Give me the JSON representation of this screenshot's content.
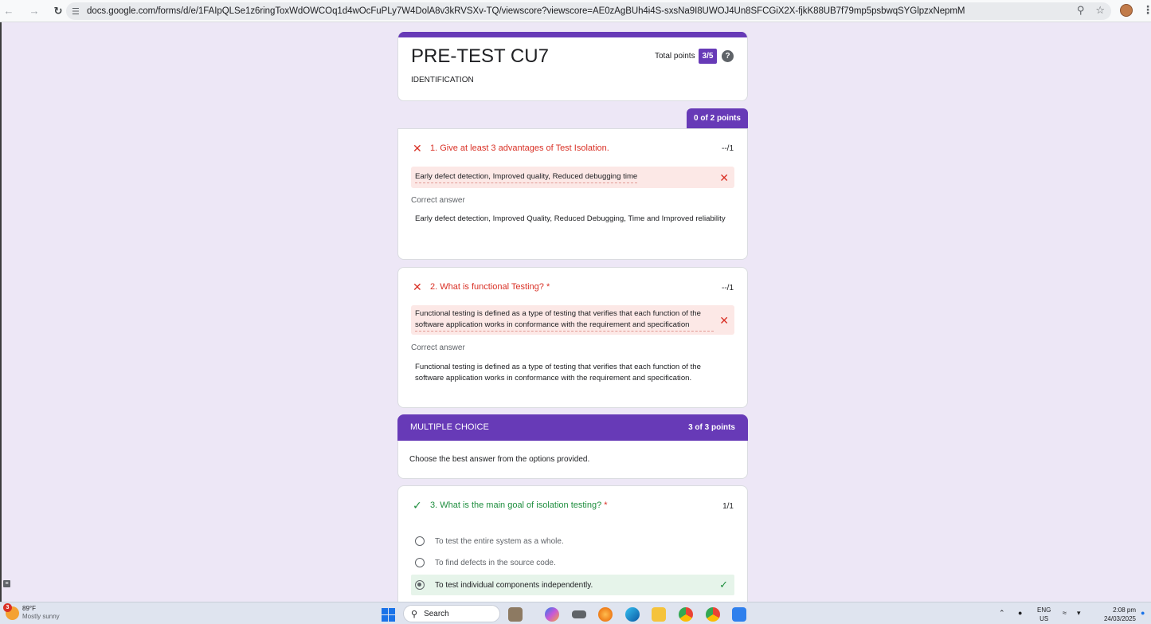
{
  "browser": {
    "url": "docs.google.com/forms/d/e/1FAIpQLSe1z6ringToxWdOWCOq1d4wOcFuPLy7W4DolA8v3kRVSXv-TQ/viewscore?viewscore=AE0zAgBUh4i4S-sxsNa9I8UWOJ4Un8SFCGiX2X-fjkK88UB7f79mp5psbwqSYGlpzxNepmM",
    "icons": [
      "back-arrow-icon",
      "forward-arrow-icon",
      "reload-icon",
      "site-info-icon",
      "zoom-icon",
      "bookmark-star-icon",
      "profile-avatar",
      "menu-kebab-icon"
    ]
  },
  "form": {
    "title": "PRE-TEST CU7",
    "description": "IDENTIFICATION",
    "total_points_label": "Total points",
    "total_points_value": "3/5",
    "help_symbol": "?",
    "accent_color": "#673ab7"
  },
  "section1": {
    "points": "0 of 2 points"
  },
  "questions": [
    {
      "number_title": "1. Give at least 3 advantages of Test Isolation.",
      "required_mark": "",
      "status": "incorrect",
      "score": "--/1",
      "response": "Early defect detection, Improved quality, Reduced debugging time",
      "correct_label": "Correct answer",
      "correct_answer": "Early defect detection, Improved Quality, Reduced Debugging, Time and Improved reliability"
    },
    {
      "number_title": "2. What is functional Testing?",
      "required_mark": "*",
      "status": "incorrect",
      "score": "--/1",
      "response": "Functional testing is defined as a type of testing that verifies that each function of the software application works in conformance with the requirement and specification",
      "correct_label": "Correct answer",
      "correct_answer": "Functional testing is defined as a type of testing that verifies that each function of the software application works in conformance with the requirement and specification."
    }
  ],
  "section2": {
    "title": "MULTIPLE CHOICE",
    "points": "3 of 3 points",
    "description": "Choose the best answer from the options provided."
  },
  "question3": {
    "number_title": "3. What is the main goal of isolation testing?",
    "required_mark": "*",
    "status": "correct",
    "score": "1/1",
    "options": [
      {
        "label": "To test the entire system as a whole.",
        "selected": false
      },
      {
        "label": "To find defects in the source code.",
        "selected": false
      },
      {
        "label": "To test individual components independently.",
        "selected": true
      }
    ]
  },
  "taskbar": {
    "weather_temp": "89°F",
    "weather_desc": "Mostly sunny",
    "weather_badge": "3",
    "search_label": "Search",
    "language": "ENG",
    "region": "US",
    "time": "2:08 pm",
    "date": "24/03/2025",
    "apps": [
      "widgets-icon",
      "copilot-icon",
      "taskview-icon",
      "firefox-icon",
      "edge-icon",
      "file-explorer-icon",
      "chrome-icon",
      "chrome-canary-icon",
      "vscode-icon"
    ]
  }
}
